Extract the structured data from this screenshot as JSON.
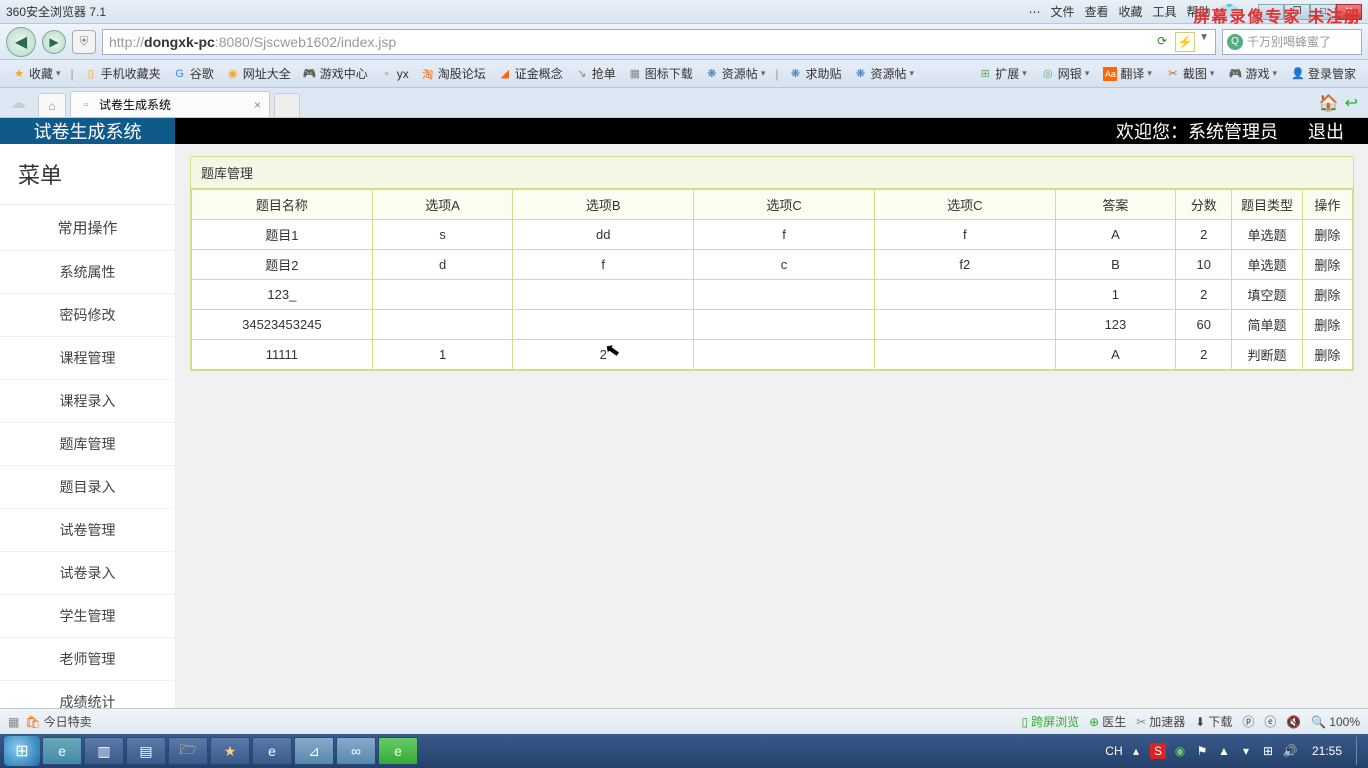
{
  "browser": {
    "title": "360安全浏览器 7.1",
    "menus": [
      "文件",
      "查看",
      "收藏",
      "工具",
      "帮助"
    ],
    "url_prefix": "http://",
    "url_host": "dongxk-pc",
    "url_rest": ":8080/Sjscweb1602/index.jsp",
    "search_placeholder": "千万别喝蜂蜜了",
    "watermark": "屏幕录像专家 未注册"
  },
  "bookmarks": {
    "collect": "收藏",
    "items": [
      "手机收藏夹",
      "谷歌",
      "网址大全",
      "游戏中心",
      "yx",
      "淘股论坛",
      "证金概念",
      "抢单",
      "图标下载",
      "资源帖",
      "求助贴",
      "资源帖"
    ],
    "right": [
      "扩展",
      "网银",
      "翻译",
      "截图",
      "游戏",
      "登录管家"
    ]
  },
  "tab": {
    "title": "试卷生成系统"
  },
  "app": {
    "title": "试卷生成系统",
    "welcome_prefix": "欢迎您：",
    "welcome_user": "系统管理员",
    "logout": "退出"
  },
  "sidebar": {
    "menu_title": "菜单",
    "section": "常用操作",
    "items": [
      "系统属性",
      "密码修改",
      "课程管理",
      "课程录入",
      "题库管理",
      "题目录入",
      "试卷管理",
      "试卷录入",
      "学生管理",
      "老师管理",
      "成绩统计"
    ]
  },
  "panel": {
    "title": "题库管理",
    "headers": [
      "题目名称",
      "选项A",
      "选项B",
      "选项C",
      "选项C",
      "答案",
      "分数",
      "题目类型",
      "操作"
    ],
    "rows": [
      {
        "c": [
          "题目1",
          "s",
          "dd",
          "f",
          "f",
          "A",
          "2",
          "单选题",
          "删除"
        ]
      },
      {
        "c": [
          "题目2",
          "d",
          "f",
          "c",
          "f2",
          "B",
          "10",
          "单选题",
          "删除"
        ]
      },
      {
        "c": [
          "123_",
          "",
          "",
          "",
          "",
          "1",
          "2",
          "填空题",
          "删除"
        ]
      },
      {
        "c": [
          "34523453245",
          "",
          "",
          "",
          "",
          "123",
          "60",
          "简单题",
          "删除"
        ]
      },
      {
        "c": [
          "11111",
          "1",
          "2",
          "",
          "",
          "A",
          "2",
          "判断题",
          "删除"
        ]
      }
    ]
  },
  "statusbar": {
    "today_sale": "今日特卖",
    "cross_screen": "跨屏浏览",
    "doctor": "医生",
    "accel": "加速器",
    "download": "下载",
    "mute_icon": "🔇",
    "zoom": "100%"
  },
  "taskbar": {
    "lang": "CH",
    "time": "21:55"
  }
}
